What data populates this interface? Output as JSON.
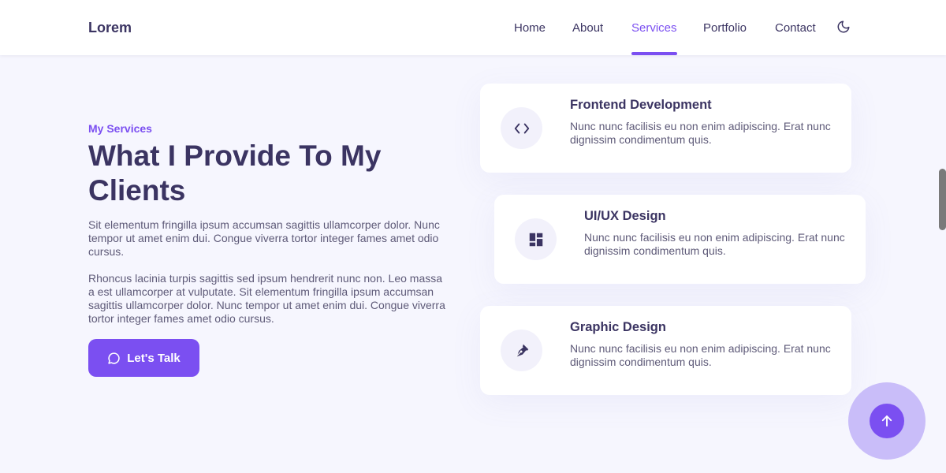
{
  "brand": "Lorem",
  "nav": {
    "items": [
      {
        "label": "Home"
      },
      {
        "label": "About"
      },
      {
        "label": "Services"
      },
      {
        "label": "Portfolio"
      },
      {
        "label": "Contact"
      }
    ],
    "active": "Services",
    "theme_toggle_icon": "moon-icon"
  },
  "hero": {
    "eyebrow": "My Services",
    "headline": "What I Provide To My Clients",
    "paragraph1": "Sit elementum fringilla ipsum accumsan sagittis ullamcorper dolor. Nunc tempor ut amet enim dui. Congue viverra tortor integer fames amet odio cursus.",
    "paragraph2": "Rhoncus lacinia turpis sagittis sed ipsum hendrerit nunc non. Leo massa a est ullamcorper at vulputate. Sit elementum fringilla ipsum accumsan sagittis ullamcorper dolor. Nunc tempor ut amet enim dui. Congue viverra tortor integer fames amet odio cursus.",
    "cta_label": "Let's Talk",
    "cta_icon": "chat-bubble-icon"
  },
  "services": [
    {
      "title": "Frontend Development",
      "description": "Nunc nunc facilisis eu non enim adipiscing. Erat nunc dignissim condimentum quis.",
      "icon": "code-icon"
    },
    {
      "title": "UI/UX Design",
      "description": "Nunc nunc facilisis eu non enim adipiscing. Erat nunc dignissim condimentum quis.",
      "icon": "layout-icon"
    },
    {
      "title": "Graphic Design",
      "description": "Nunc nunc facilisis eu non enim adipiscing. Erat nunc dignissim condimentum quis.",
      "icon": "pen-nib-icon"
    }
  ],
  "scroll_top_icon": "arrow-up-icon",
  "colors": {
    "accent": "#7b4ff1",
    "heading": "#3b3462",
    "body_text": "#5e5a78",
    "background": "#f6f6fe",
    "halo": "#c9bdf9"
  }
}
